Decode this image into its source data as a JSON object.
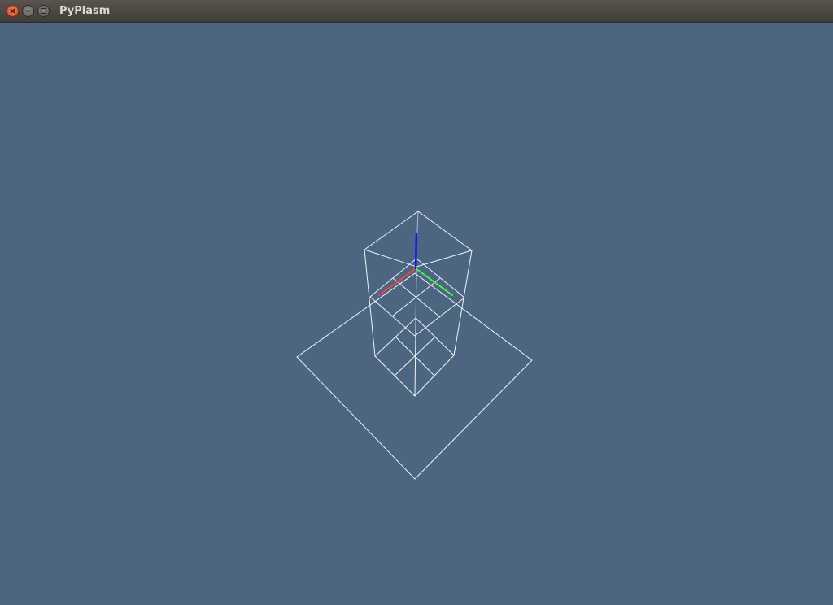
{
  "window": {
    "title": "PyPlasm"
  },
  "titlebar": {
    "buttons": [
      {
        "name": "close",
        "icon": "close-icon"
      },
      {
        "name": "minimize",
        "icon": "minimize-icon"
      },
      {
        "name": "maximize",
        "icon": "maximize-icon"
      }
    ]
  },
  "viewport": {
    "background": "#4c6580",
    "wire_color": "#ffffff",
    "axes": {
      "x": "#ff3b3b",
      "y": "#3cff3c",
      "z": "#1414ff"
    }
  }
}
